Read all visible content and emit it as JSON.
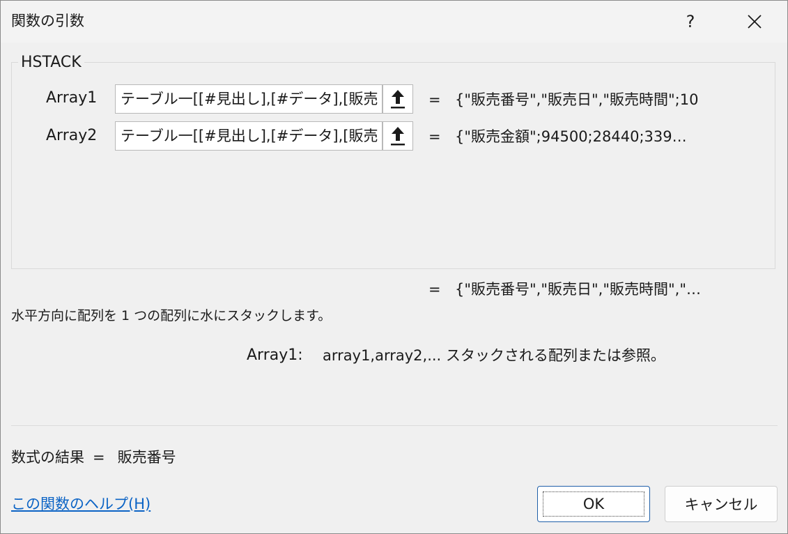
{
  "window": {
    "title": "関数の引数",
    "help_button": "?",
    "close_icon": "close-icon"
  },
  "function": {
    "name": "HSTACK",
    "arguments": [
      {
        "label": "Array1",
        "input_value": "テーブル一[[#見出し],[#データ],[販売",
        "result": "{\"販売番号\",\"販売日\",\"販売時間\";10"
      },
      {
        "label": "Array2",
        "input_value": "テーブル一[[#見出し],[#データ],[販売",
        "result": "{\"販売金額\";94500;28440;339…"
      }
    ],
    "equals": "=",
    "result_preview": "{\"販売番号\",\"販売日\",\"販売時間\",\"…",
    "description": "水平方向に配列を 1 つの配列に水にスタックします。",
    "arg_help_name": "Array1:",
    "arg_help_text": "array1,array2,... スタックされる配列または参照。"
  },
  "formula_result": {
    "label": "数式の結果",
    "equals": "=",
    "value": "販売番号"
  },
  "footer": {
    "help_link": "この関数のヘルプ(H)",
    "ok_label": "OK",
    "cancel_label": "キャンセル"
  },
  "icons": {
    "ref_button_icon": "collapse-dialog-arrow-icon"
  },
  "colors": {
    "link": "#0b63c5",
    "ok_border": "#1f5fa8",
    "background": "#f0f0f0"
  }
}
